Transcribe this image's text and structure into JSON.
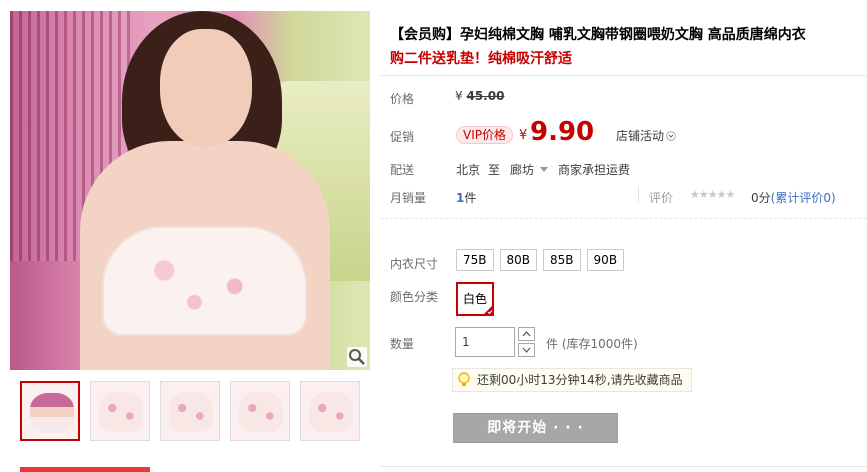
{
  "product": {
    "title": "【会员购】孕妇纯棉文胸 哺乳文胸带钢圈喂奶文胸 高品质唐绵内衣",
    "subtitle": "购二件送乳垫！纯棉吸汗舒适"
  },
  "price": {
    "label": "价格",
    "currency": "¥",
    "original": "45.00"
  },
  "promo": {
    "label": "促销",
    "vip_tag": "VIP价格",
    "currency": "¥",
    "price": "9.90",
    "store_activity": "店铺活动"
  },
  "shipping": {
    "label": "配送",
    "from": "北京",
    "to_word": "至",
    "destination": "廊坊",
    "fee": "商家承担运费"
  },
  "sales": {
    "label": "月销量",
    "count": "1",
    "unit": "件",
    "rating_label": "评价",
    "stars": "★★★★★",
    "score": "0分",
    "rating_link": "(累计评价0)"
  },
  "size": {
    "label": "内衣尺寸",
    "options": [
      "75B",
      "80B",
      "85B",
      "90B"
    ]
  },
  "color": {
    "label": "颜色分类",
    "option": "白色"
  },
  "quantity": {
    "label": "数量",
    "value": "1",
    "unit_stock": "件 (库存1000件)"
  },
  "countdown": {
    "text": "还剩00小时13分钟14秒,请先收藏商品"
  },
  "buy": {
    "button_label": "即将开始 · · ·"
  },
  "colors": {
    "accent": "#c40000",
    "link": "#3c6fc4",
    "button_disabled": "#a7a7a7"
  }
}
